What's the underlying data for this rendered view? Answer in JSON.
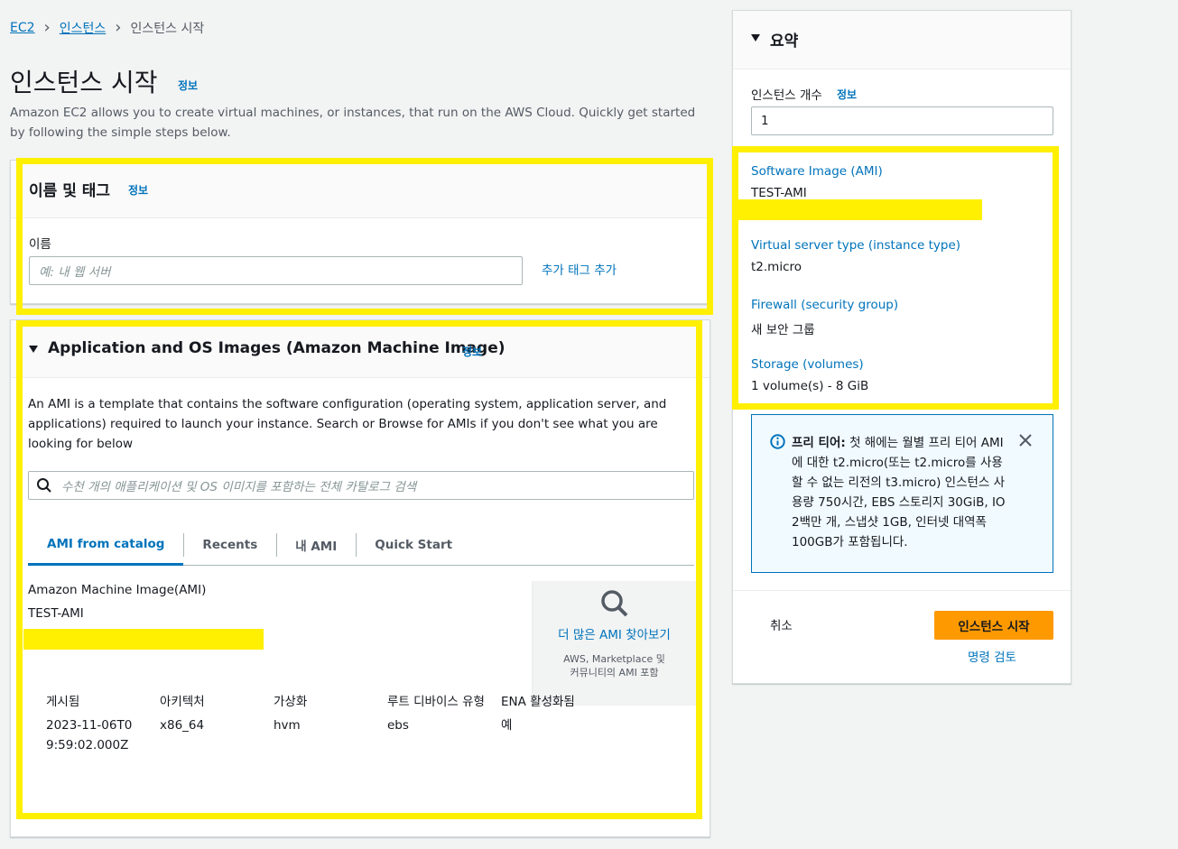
{
  "breadcrumb": {
    "items": [
      "EC2",
      "인스턴스",
      "인스턴스 시작"
    ]
  },
  "page": {
    "title": "인스턴스 시작",
    "info": "정보",
    "description": "Amazon EC2 allows you to create virtual machines, or instances, that run on the AWS Cloud. Quickly get started by following the simple steps below."
  },
  "name_tags": {
    "title": "이름 및 태그",
    "info": "정보",
    "name_label": "이름",
    "name_placeholder": "예: 내 웹 서버",
    "add_tags": "추가 태그 추가"
  },
  "ami": {
    "title": "Application and OS Images (Amazon Machine Image)",
    "info": "정보",
    "description": "An AMI is a template that contains the software configuration (operating system, application server, and applications) required to launch your instance. Search or Browse for AMIs if you don't see what you are looking for below",
    "search_placeholder": "수천 개의 애플리케이션 및 OS 이미지를 포함하는 전체 카탈로그 검색",
    "tabs": [
      "AMI from catalog",
      "Recents",
      "내 AMI",
      "Quick Start"
    ],
    "selected_label": "Amazon Machine Image(AMI)",
    "selected_name": "TEST-AMI",
    "browse_title": "더 많은 AMI 찾아보기",
    "browse_sub": "AWS, Marketplace 및 커뮤니티의 AMI 포함",
    "details": {
      "published_label": "게시됨",
      "published_value": "2023-11-06T09:59:02.000Z",
      "arch_label": "아키텍처",
      "arch_value": "x86_64",
      "virt_label": "가상화",
      "virt_value": "hvm",
      "root_label": "루트 디바이스 유형",
      "root_value": "ebs",
      "ena_label": "ENA 활성화됨",
      "ena_value": "예"
    }
  },
  "summary": {
    "title": "요약",
    "count_label": "인스턴스 개수",
    "count_info": "정보",
    "count_value": "1",
    "ami_label": "Software Image (AMI)",
    "ami_value": "TEST-AMI",
    "type_label": "Virtual server type (instance type)",
    "type_value": "t2.micro",
    "firewall_label": "Firewall (security group)",
    "firewall_value": "새 보안 그룹",
    "storage_label": "Storage (volumes)",
    "storage_value": "1 volume(s) - 8 GiB",
    "free_tier_bold": "프리 티어:",
    "free_tier_text": " 첫 해에는 월별 프리 티어 AMI에 대한 t2.micro(또는 t2.micro를 사용할 수 없는 리전의 t3.micro) 인스턴스 사용량 750시간, EBS 스토리지 30GiB, IO 2백만 개, 스냅샷 1GB, 인터넷 대역폭 100GB가 포함됩니다.",
    "cancel": "취소",
    "launch": "인스턴스 시작",
    "review": "명령 검토"
  },
  "colors": {
    "accent": "#0073bb",
    "primary_button": "#ff9900",
    "highlight": "#ffef00"
  }
}
